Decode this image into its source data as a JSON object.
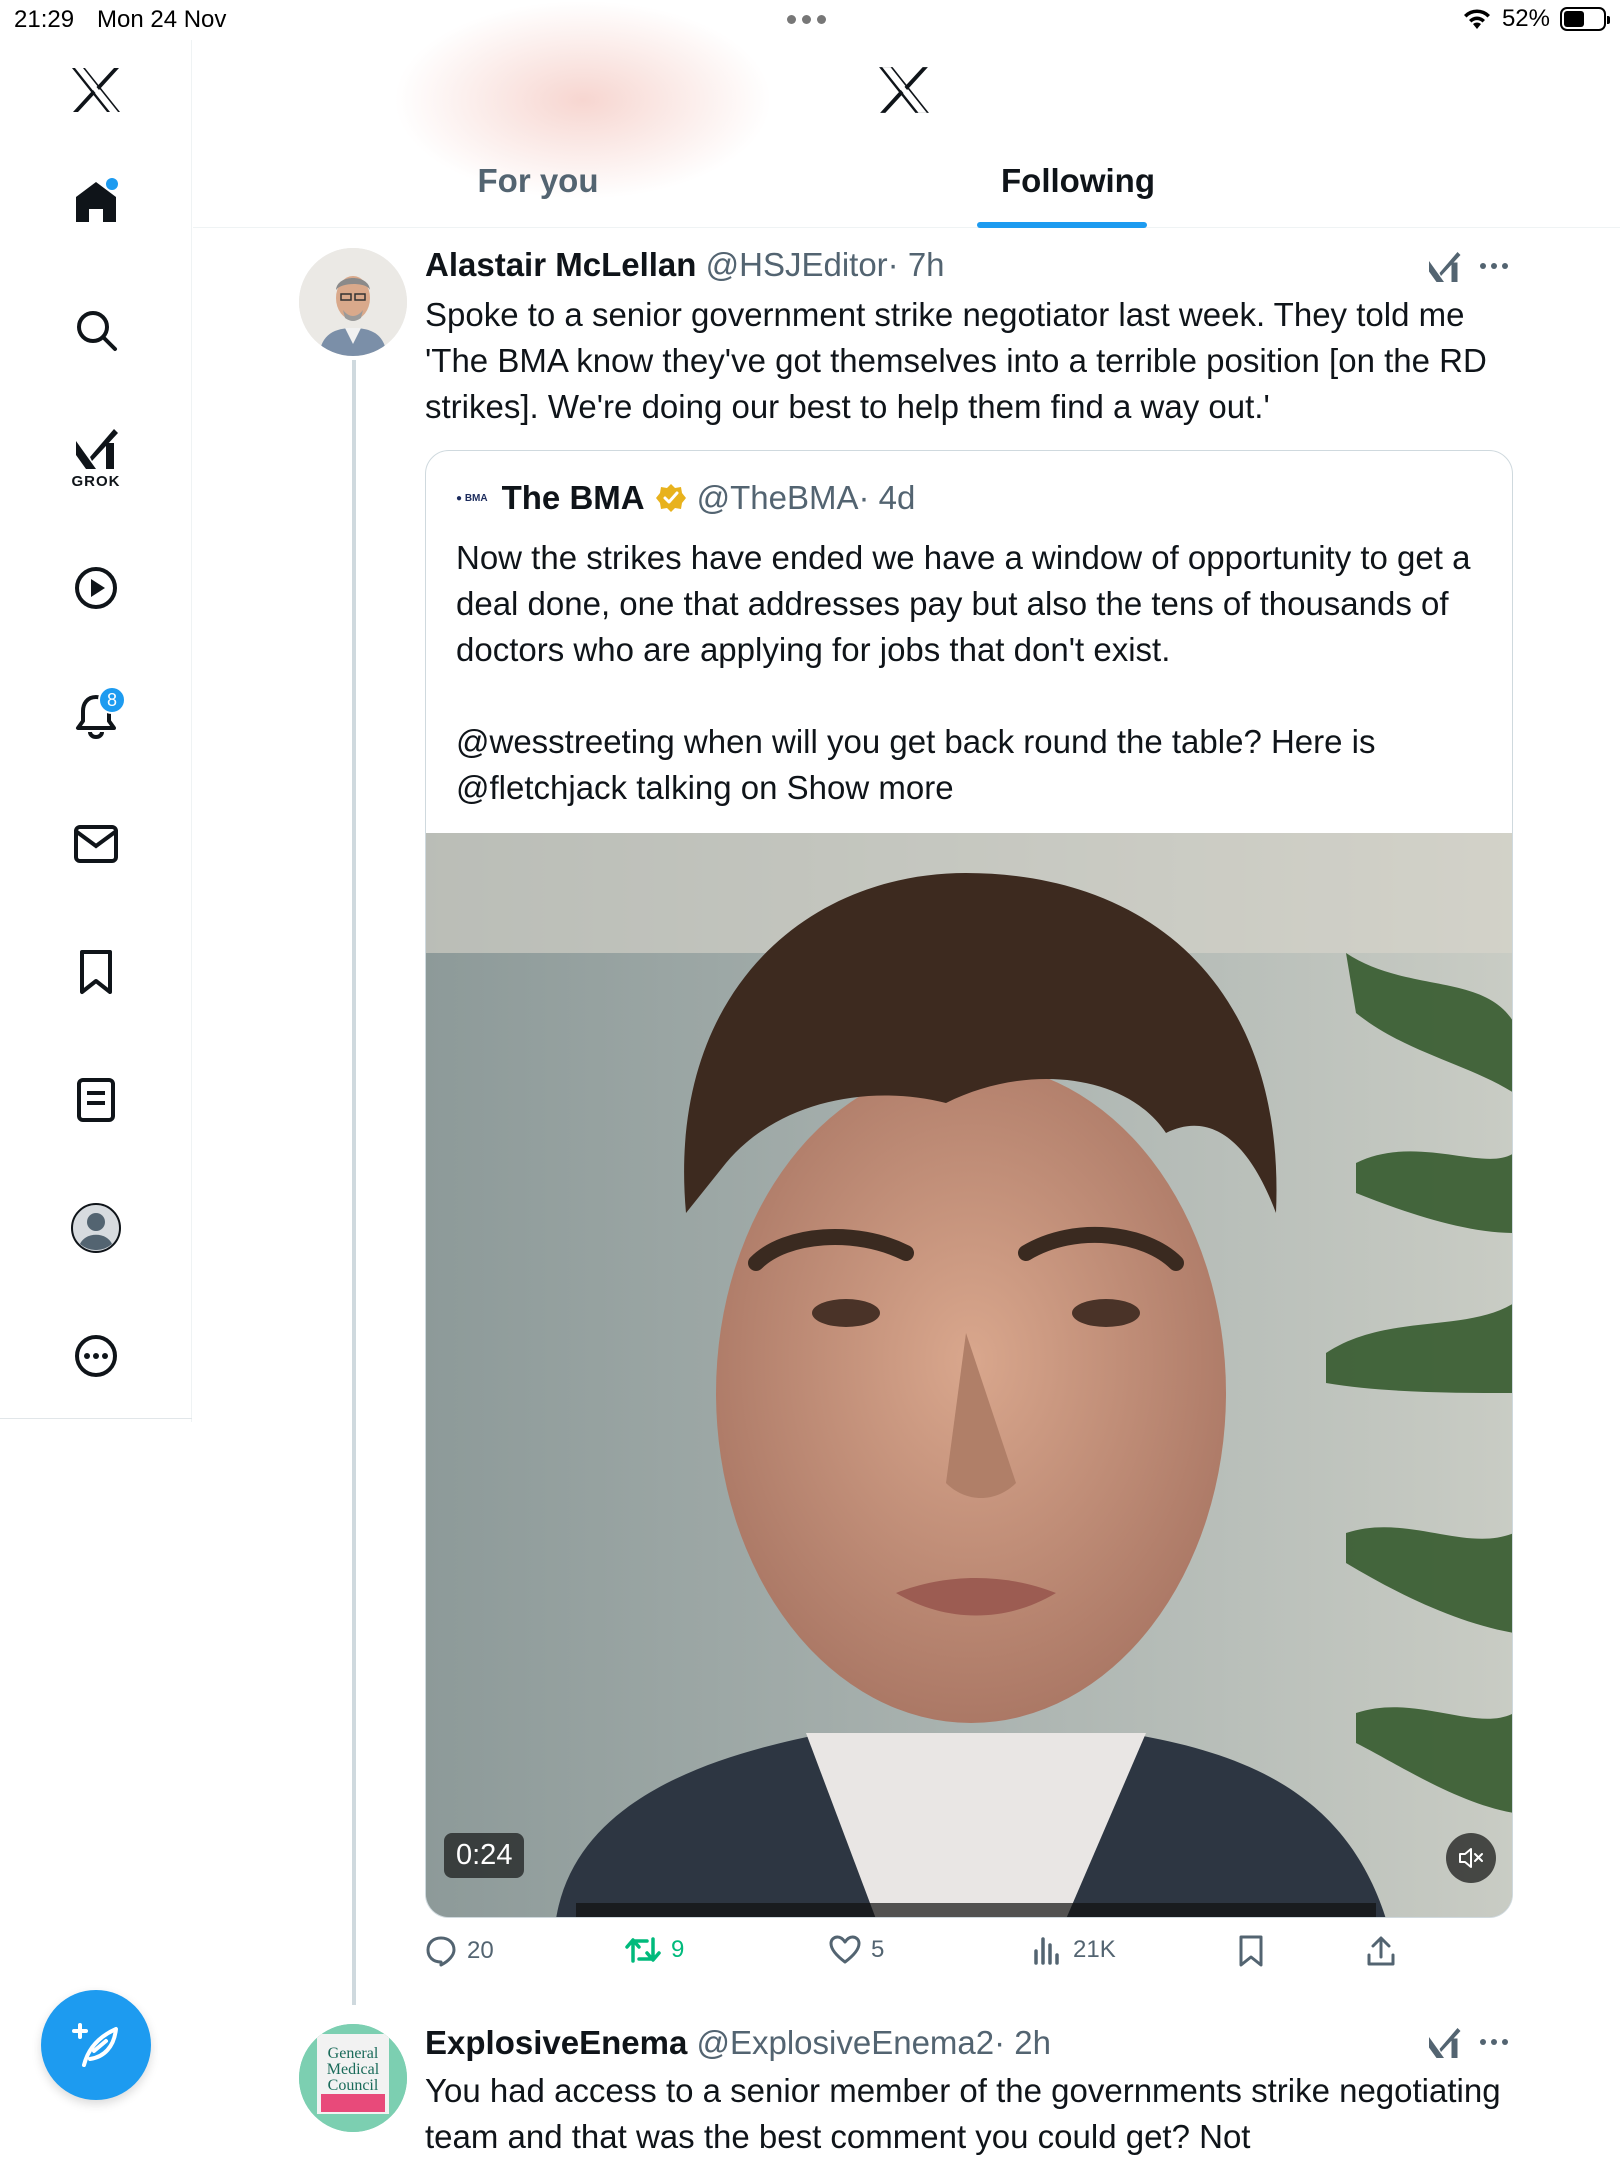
{
  "status_bar": {
    "time": "21:29",
    "date": "Mon 24 Nov",
    "battery": "52%",
    "battery_level": 0.52
  },
  "sidebar": {
    "items": [
      {
        "name": "x-logo",
        "label": ""
      },
      {
        "name": "home",
        "label": ""
      },
      {
        "name": "search",
        "label": ""
      },
      {
        "name": "grok",
        "label": "GROK"
      },
      {
        "name": "video",
        "label": ""
      },
      {
        "name": "notifications",
        "label": "",
        "badge": "8"
      },
      {
        "name": "messages",
        "label": ""
      },
      {
        "name": "bookmarks",
        "label": ""
      },
      {
        "name": "lists",
        "label": ""
      },
      {
        "name": "profile",
        "label": ""
      },
      {
        "name": "more",
        "label": ""
      }
    ]
  },
  "header": {
    "tabs": [
      {
        "label": "For you",
        "active": false
      },
      {
        "label": "Following",
        "active": true
      }
    ]
  },
  "tweets": [
    {
      "name": "Alastair McLellan",
      "handle": "@HSJEditor",
      "time": "· 7h",
      "text": "Spoke to a senior government strike negotiator last week. They told me 'The BMA know they've got themselves into a terrible position [on the RD strikes]. We're doing our best to help them find a way out.'",
      "quote": {
        "logo_text": "BMA",
        "name": "The BMA",
        "handle": "@TheBMA",
        "time": "· 4d",
        "text_p1": "Now the strikes have ended we have a window of opportunity to get a deal done, one that addresses pay but also the tens of thousands of doctors who are applying for jobs that don't exist.",
        "mention1": "@wesstreeting",
        "text_p2": " when will you get back round the table? Here is",
        "mention2": "@fletchjack",
        "text_p3": " talking on ",
        "show_more": "Show more",
        "video_time": "0:24"
      },
      "stats": {
        "replies": "20",
        "reposts": "9",
        "likes": "5",
        "views": "21K"
      }
    },
    {
      "name": "ExplosiveEnema",
      "handle": "@ExplosiveEnema2",
      "time": "· 2h",
      "avatar_text": "General Medical Council",
      "text": "You had access to a senior member of the governments strike negotiating team and that was the best comment you could get? Not"
    }
  ],
  "colors": {
    "accent": "#1d9bf0",
    "repost": "#00ba7c",
    "secondary": "#536471"
  }
}
